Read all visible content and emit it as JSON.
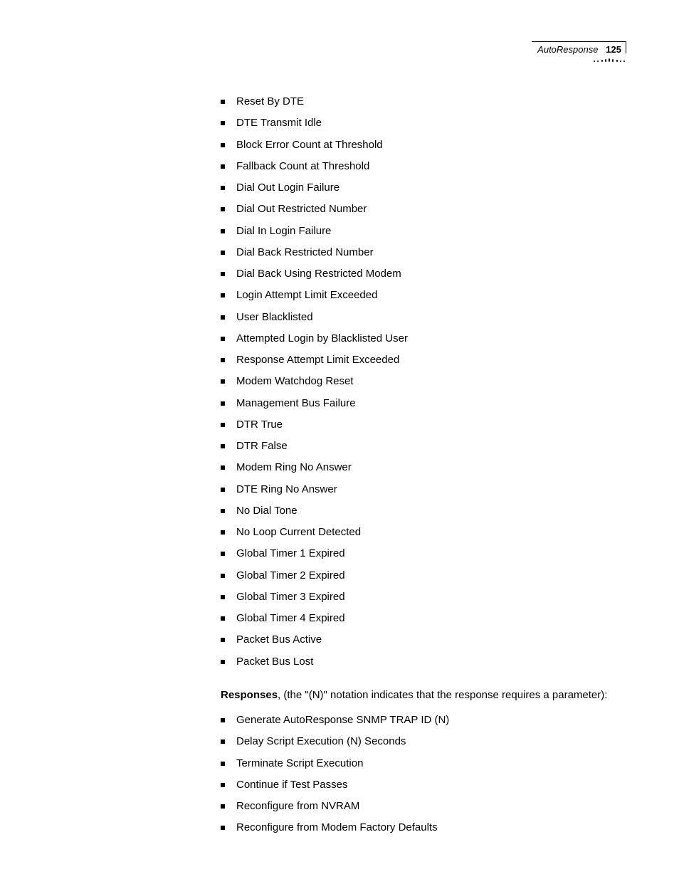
{
  "header": {
    "section": "AutoResponse",
    "page_number": "125"
  },
  "events": [
    "Reset By DTE",
    "DTE Transmit Idle",
    "Block Error Count at Threshold",
    "Fallback Count at Threshold",
    "Dial Out Login Failure",
    "Dial Out Restricted Number",
    "Dial In Login Failure",
    "Dial Back Restricted Number",
    "Dial Back Using Restricted Modem",
    "Login Attempt Limit Exceeded",
    "User Blacklisted",
    "Attempted Login by Blacklisted User",
    "Response Attempt Limit Exceeded",
    "Modem Watchdog Reset",
    "Management Bus Failure",
    "DTR True",
    "DTR False",
    "Modem Ring No Answer",
    "DTE Ring No Answer",
    "No Dial Tone",
    "No Loop Current Detected",
    "Global Timer 1 Expired",
    "Global Timer 2 Expired",
    "Global Timer 3 Expired",
    "Global Timer 4 Expired",
    "Packet Bus Active",
    "Packet Bus Lost"
  ],
  "responses_intro": {
    "label": "Responses",
    "text": ", (the \"(N)\" notation indicates that the response requires a parameter):"
  },
  "responses": [
    "Generate AutoResponse SNMP TRAP ID (N)",
    "Delay Script Execution (N) Seconds",
    "Terminate Script Execution",
    "Continue if Test Passes",
    "Reconfigure from NVRAM",
    "Reconfigure from Modem Factory Defaults"
  ]
}
